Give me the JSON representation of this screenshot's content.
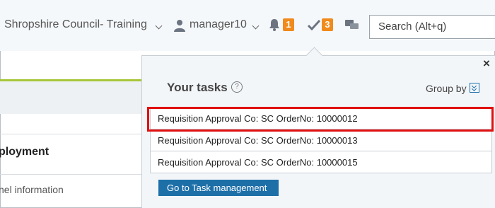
{
  "header": {
    "org_name": "Shropshire Council- Training",
    "user_name": "manager10",
    "notification_count": "1",
    "task_count": "3",
    "search_placeholder": "Search (Alt+q)"
  },
  "page": {
    "section_heading": "ployment",
    "section_text": "nel information"
  },
  "tasks_panel": {
    "title": "Your tasks",
    "help_glyph": "?",
    "group_by_label": "Group by",
    "close_glyph": "×",
    "tasks": [
      {
        "label": "Requisition Approval Co: SC OrderNo: 10000012"
      },
      {
        "label": "Requisition Approval Co: SC OrderNo: 10000013"
      },
      {
        "label": "Requisition Approval Co: SC OrderNo: 10000015"
      }
    ],
    "go_button_label": "Go to Task management"
  },
  "colors": {
    "accent": "#1d6fa8",
    "badge": "#f08a1c",
    "highlight": "#e01010",
    "tab_underline": "#a7c63a"
  },
  "icons": [
    "user-icon",
    "bell-icon",
    "checkmark-icon",
    "chat-icon",
    "help-icon",
    "group-by-icon",
    "close-icon",
    "chevron-down-icon"
  ]
}
